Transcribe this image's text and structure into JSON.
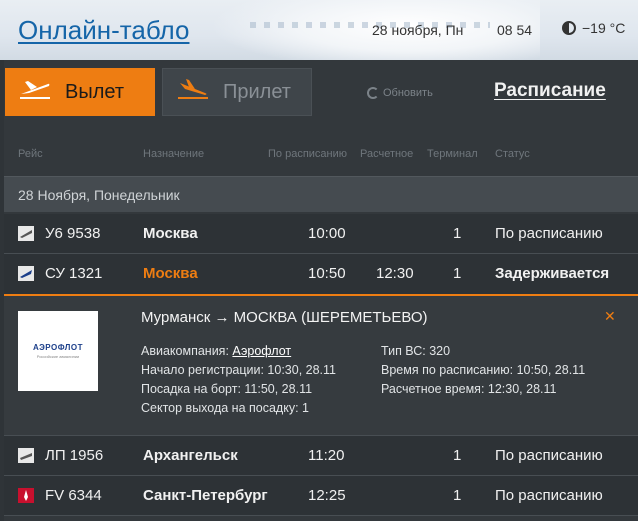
{
  "header": {
    "title": "Онлайн-табло",
    "date": "28 ноября, Пн",
    "time": "08 54",
    "weather": "−19 °C"
  },
  "tabs": {
    "departure": "Вылет",
    "arrival": "Прилет"
  },
  "toolbar": {
    "refresh": "Обновить",
    "schedule": "Расписание"
  },
  "columns": {
    "flight": "Рейс",
    "destination": "Назначение",
    "scheduled": "По расписанию",
    "estimated": "Расчетное",
    "terminal": "Терминал",
    "status": "Статус"
  },
  "group_date": "28 Ноября, Понедельник",
  "flights": [
    {
      "flight": "У6 9538",
      "destination": "Москва",
      "scheduled": "10:00",
      "estimated": "",
      "terminal": "1",
      "status": "По расписанию"
    },
    {
      "flight": "СУ 1321",
      "destination": "Москва",
      "scheduled": "10:50",
      "estimated": "12:30",
      "terminal": "1",
      "status": "Задерживается"
    },
    {
      "flight": "ЛП 1956",
      "destination": "Архангельск",
      "scheduled": "11:20",
      "estimated": "",
      "terminal": "1",
      "status": "По расписанию"
    },
    {
      "flight": "FV 6344",
      "destination": "Санкт-Петербург",
      "scheduled": "12:25",
      "estimated": "",
      "terminal": "1",
      "status": "По расписанию"
    }
  ],
  "details": {
    "logo_text": "АЭРОФЛОТ",
    "logo_sub": "Российские авиалинии",
    "route": "Мурманск → МОСКВА (ШЕРЕМЕТЬЕВО)",
    "airline_label": "Авиакомпания:",
    "airline_value": "Аэрофлот",
    "checkin": "Начало регистрации: 10:30, 28.11",
    "boarding": "Посадка на борт: 11:50, 28.11",
    "gate": "Сектор выхода на посадку: 1",
    "aircraft": "Тип ВС: 320",
    "sched_time": "Время по расписанию: 10:50, 28.11",
    "est_time": "Расчетное время: 12:30, 28.11",
    "close": "✕"
  },
  "colors": {
    "accent": "#ee7d12",
    "title_blue": "#1565a8",
    "board_bg": "#33383c"
  }
}
